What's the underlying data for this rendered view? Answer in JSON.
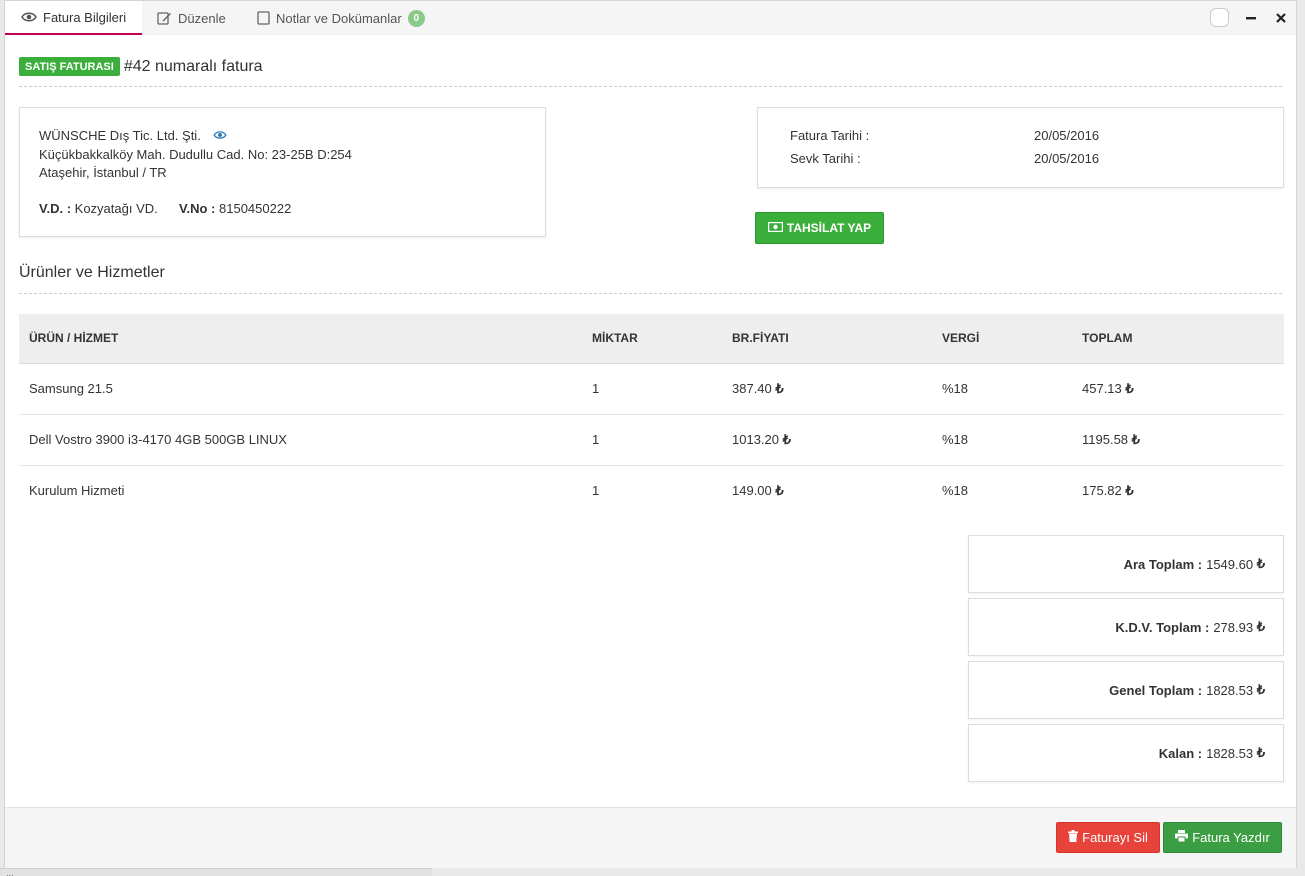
{
  "tabs": [
    {
      "label": "Fatura Bilgileri",
      "icon": "eye-icon"
    },
    {
      "label": "Düzenle",
      "icon": "edit-icon"
    },
    {
      "label": "Notlar ve Dokümanlar",
      "icon": "document-icon",
      "badge": "0"
    }
  ],
  "header": {
    "type_label": "SATIŞ FATURASI",
    "title": "#42 numaralı fatura"
  },
  "customer": {
    "name": "WÜNSCHE Dış Tic. Ltd. Şti.",
    "address1": "Küçükbakkalköy Mah. Dudullu Cad. No: 23-25B D:254",
    "address2": "Ataşehir, İstanbul / TR",
    "vd_label": "V.D. :",
    "vd_value": "Kozyatağı VD.",
    "vno_label": "V.No :",
    "vno_value": "8150450222"
  },
  "dates": {
    "invoice_label": "Fatura Tarihi :",
    "invoice_value": "20/05/2016",
    "ship_label": "Sevk Tarihi :",
    "ship_value": "20/05/2016"
  },
  "collect_button": "TAHSİLAT YAP",
  "section_title": "Ürünler ve Hizmetler",
  "table": {
    "headers": [
      "ÜRÜN / HİZMET",
      "MİKTAR",
      "BR.FİYATI",
      "VERGİ",
      "TOPLAM"
    ],
    "rows": [
      [
        "Samsung 21.5",
        "1",
        "387.40",
        "%18",
        "457.13"
      ],
      [
        "Dell Vostro 3900 i3-4170 4GB 500GB LINUX",
        "1",
        "1013.20",
        "%18",
        "1195.58"
      ],
      [
        "Kurulum Hizmeti",
        "1",
        "149.00",
        "%18",
        "175.82"
      ]
    ]
  },
  "currency_symbol": "₺",
  "summary": [
    {
      "label": "Ara Toplam :",
      "value": "1549.60"
    },
    {
      "label": "K.D.V. Toplam :",
      "value": "278.93"
    },
    {
      "label": "Genel Toplam :",
      "value": "1828.53"
    },
    {
      "label": "Kalan :",
      "value": "1828.53"
    }
  ],
  "footer": {
    "delete_label": "Faturayı Sil",
    "print_label": "Fatura Yazdır"
  },
  "status_text": "...",
  "colors": {
    "accent": "#c5005a",
    "green": "#3cae3c",
    "red": "#e8433b"
  }
}
